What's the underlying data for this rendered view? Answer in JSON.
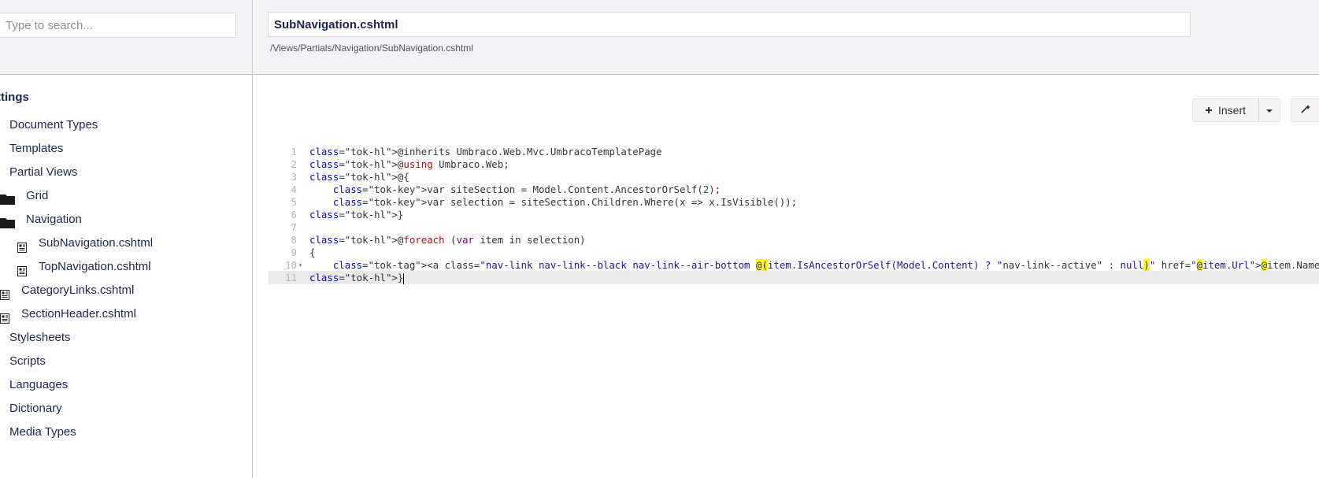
{
  "sidebar": {
    "search": {
      "placeholder": "Type to search..."
    },
    "section_title": "ttings",
    "items": [
      {
        "label": "Document Types",
        "icon": "none"
      },
      {
        "label": "Templates",
        "icon": "none"
      },
      {
        "label": "Partial Views",
        "icon": "none"
      },
      {
        "label": "Grid",
        "icon": "folder-icon"
      },
      {
        "label": "Navigation",
        "icon": "folder-icon"
      },
      {
        "label": "SubNavigation.cshtml",
        "icon": "file-icon"
      },
      {
        "label": "TopNavigation.cshtml",
        "icon": "file-icon"
      },
      {
        "label": "CategoryLinks.cshtml",
        "icon": "file-icon"
      },
      {
        "label": "SectionHeader.cshtml",
        "icon": "file-icon"
      },
      {
        "label": "Stylesheets",
        "icon": "none"
      },
      {
        "label": "Scripts",
        "icon": "none"
      },
      {
        "label": "Languages",
        "icon": "none"
      },
      {
        "label": "Dictionary",
        "icon": "none"
      },
      {
        "label": "Media Types",
        "icon": "none"
      }
    ]
  },
  "editor": {
    "file_name": "SubNavigation.cshtml",
    "file_path": "/Views/Partials/Navigation/SubNavigation.cshtml",
    "toolbar": {
      "insert_label": "Insert",
      "insert_icon": "plus-icon",
      "caret_icon": "caret-down-icon",
      "query_icon": "wand-icon"
    },
    "code": {
      "active_line": 11,
      "lines": [
        "@inherits Umbraco.Web.Mvc.UmbracoTemplatePage",
        "@using Umbraco.Web;",
        "@{",
        "    var siteSection = Model.Content.AncestorOrSelf(2);",
        "    var selection = siteSection.Children.Where(x => x.IsVisible());",
        "}",
        "",
        "@foreach (var item in selection)",
        "{",
        "    <a class=\"nav-link nav-link--black nav-link--air-bottom @(item.IsAncestorOrSelf(Model.Content) ? \"nav-link--active\" : null)\" href=\"@item.Url\">@item.Name</a>",
        "}"
      ]
    }
  },
  "colors": {
    "header_bg": "#f3f3f5",
    "text": "#1b264f",
    "highlight": "#ffff00",
    "keyword": "#aa1111",
    "string": "#221199"
  }
}
